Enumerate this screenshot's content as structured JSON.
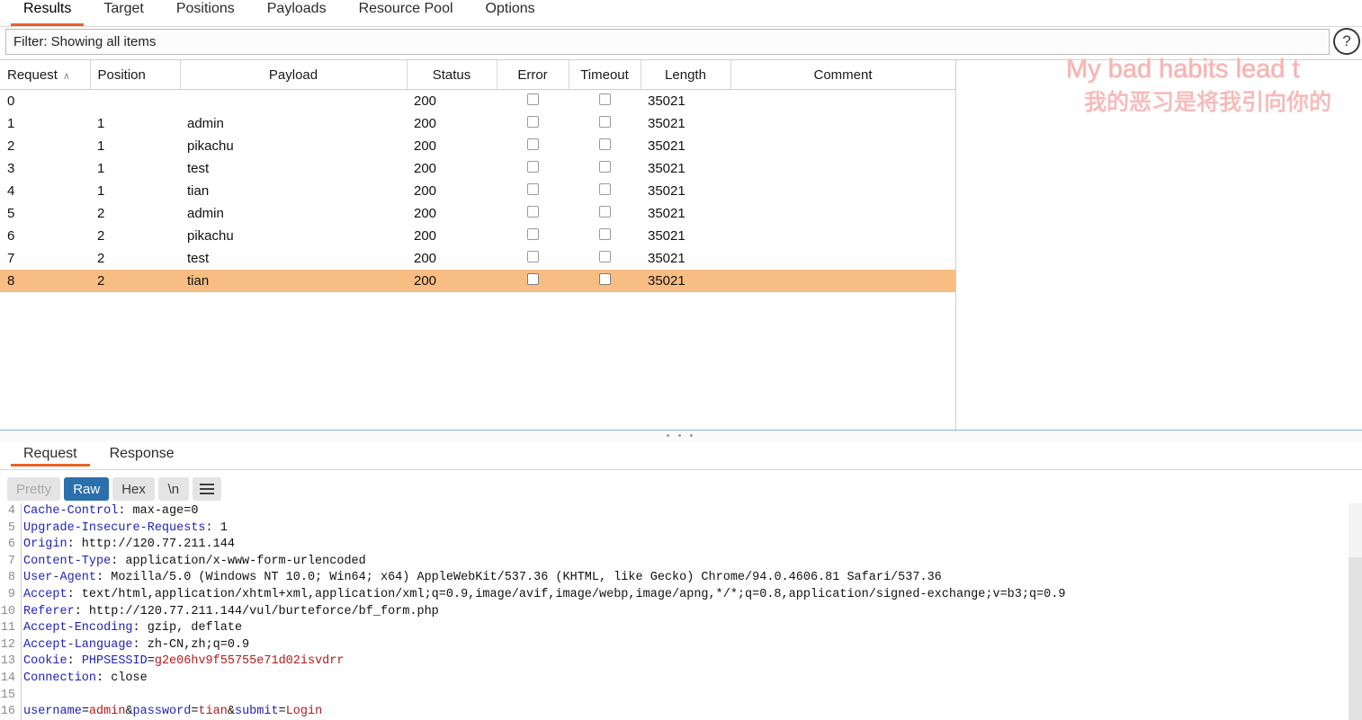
{
  "top_tabs": [
    {
      "label": "Results",
      "active": true
    },
    {
      "label": "Target",
      "active": false
    },
    {
      "label": "Positions",
      "active": false
    },
    {
      "label": "Payloads",
      "active": false
    },
    {
      "label": "Resource Pool",
      "active": false
    },
    {
      "label": "Options",
      "active": false
    }
  ],
  "filter": {
    "text": "Filter: Showing all items"
  },
  "help_icon": "?",
  "table": {
    "columns": [
      "Request",
      "Position",
      "Payload",
      "Status",
      "Error",
      "Timeout",
      "Length",
      "Comment"
    ],
    "sort_column": "Request",
    "sort_caret": "∧",
    "rows": [
      {
        "request": "0",
        "position": "",
        "payload": "",
        "status": "200",
        "error": false,
        "timeout": false,
        "length": "35021",
        "comment": "",
        "selected": false
      },
      {
        "request": "1",
        "position": "1",
        "payload": "admin",
        "status": "200",
        "error": false,
        "timeout": false,
        "length": "35021",
        "comment": "",
        "selected": false
      },
      {
        "request": "2",
        "position": "1",
        "payload": "pikachu",
        "status": "200",
        "error": false,
        "timeout": false,
        "length": "35021",
        "comment": "",
        "selected": false
      },
      {
        "request": "3",
        "position": "1",
        "payload": "test",
        "status": "200",
        "error": false,
        "timeout": false,
        "length": "35021",
        "comment": "",
        "selected": false
      },
      {
        "request": "4",
        "position": "1",
        "payload": "tian",
        "status": "200",
        "error": false,
        "timeout": false,
        "length": "35021",
        "comment": "",
        "selected": false
      },
      {
        "request": "5",
        "position": "2",
        "payload": "admin",
        "status": "200",
        "error": false,
        "timeout": false,
        "length": "35021",
        "comment": "",
        "selected": false
      },
      {
        "request": "6",
        "position": "2",
        "payload": "pikachu",
        "status": "200",
        "error": false,
        "timeout": false,
        "length": "35021",
        "comment": "",
        "selected": false
      },
      {
        "request": "7",
        "position": "2",
        "payload": "test",
        "status": "200",
        "error": false,
        "timeout": false,
        "length": "35021",
        "comment": "",
        "selected": false
      },
      {
        "request": "8",
        "position": "2",
        "payload": "tian",
        "status": "200",
        "error": false,
        "timeout": false,
        "length": "35021",
        "comment": "",
        "selected": true
      }
    ],
    "selected_row_color": "#f7bd83"
  },
  "splitter": {
    "handle": "• • •"
  },
  "message_tabs": [
    {
      "label": "Request",
      "active": true
    },
    {
      "label": "Response",
      "active": false
    }
  ],
  "view_toolbar": {
    "buttons": [
      {
        "label": "Pretty",
        "state": "disabled"
      },
      {
        "label": "Raw",
        "state": "active"
      },
      {
        "label": "Hex",
        "state": "normal"
      },
      {
        "label": "\\n",
        "state": "normal"
      }
    ],
    "menu_icon": "hamburger-icon"
  },
  "request_editor": {
    "first_line_number": 4,
    "lines": [
      {
        "n": "4",
        "segments": [
          {
            "t": "Cache-Control",
            "c": "key"
          },
          {
            "t": ": max-age=0",
            "c": "val"
          }
        ]
      },
      {
        "n": "5",
        "segments": [
          {
            "t": "Upgrade-Insecure-Requests",
            "c": "key"
          },
          {
            "t": ": 1",
            "c": "val"
          }
        ]
      },
      {
        "n": "6",
        "segments": [
          {
            "t": "Origin",
            "c": "key"
          },
          {
            "t": ": http://120.77.211.144",
            "c": "val"
          }
        ]
      },
      {
        "n": "7",
        "segments": [
          {
            "t": "Content-Type",
            "c": "key"
          },
          {
            "t": ": application/x-www-form-urlencoded",
            "c": "val"
          }
        ]
      },
      {
        "n": "8",
        "segments": [
          {
            "t": "User-Agent",
            "c": "key"
          },
          {
            "t": ": Mozilla/5.0 (Windows NT 10.0; Win64; x64) AppleWebKit/537.36 (KHTML, like Gecko) Chrome/94.0.4606.81 Safari/537.36",
            "c": "val"
          }
        ]
      },
      {
        "n": "9",
        "segments": [
          {
            "t": "Accept",
            "c": "key"
          },
          {
            "t": ": text/html,application/xhtml+xml,application/xml;q=0.9,image/avif,image/webp,image/apng,*/*;q=0.8,application/signed-exchange;v=b3;q=0.9",
            "c": "val"
          }
        ]
      },
      {
        "n": "10",
        "segments": [
          {
            "t": "Referer",
            "c": "key"
          },
          {
            "t": ": http://120.77.211.144/vul/burteforce/bf_form.php",
            "c": "val"
          }
        ]
      },
      {
        "n": "11",
        "segments": [
          {
            "t": "Accept-Encoding",
            "c": "key"
          },
          {
            "t": ": gzip, deflate",
            "c": "val"
          }
        ]
      },
      {
        "n": "12",
        "segments": [
          {
            "t": "Accept-Language",
            "c": "key"
          },
          {
            "t": ": zh-CN,zh;q=0.9",
            "c": "val"
          }
        ]
      },
      {
        "n": "13",
        "segments": [
          {
            "t": "Cookie",
            "c": "key"
          },
          {
            "t": ": ",
            "c": "val"
          },
          {
            "t": "PHPSESSID",
            "c": "key"
          },
          {
            "t": "=",
            "c": "val"
          },
          {
            "t": "g2e06hv9f55755e71d02isvdrr",
            "c": "red"
          }
        ]
      },
      {
        "n": "14",
        "segments": [
          {
            "t": "Connection",
            "c": "key"
          },
          {
            "t": ": close",
            "c": "val"
          }
        ]
      },
      {
        "n": "15",
        "segments": []
      },
      {
        "n": "16",
        "segments": [
          {
            "t": "username",
            "c": "key"
          },
          {
            "t": "=",
            "c": "val"
          },
          {
            "t": "admin",
            "c": "red"
          },
          {
            "t": "&",
            "c": "val"
          },
          {
            "t": "password",
            "c": "key"
          },
          {
            "t": "=",
            "c": "val"
          },
          {
            "t": "tian",
            "c": "red"
          },
          {
            "t": "&",
            "c": "val"
          },
          {
            "t": "submit",
            "c": "key"
          },
          {
            "t": "=",
            "c": "val"
          },
          {
            "t": "Login",
            "c": "red"
          }
        ]
      }
    ]
  },
  "watermark": {
    "line1": "My bad habits lead t",
    "line2": "我的恶习是将我引向你的",
    "color": "#f6b0b0"
  }
}
